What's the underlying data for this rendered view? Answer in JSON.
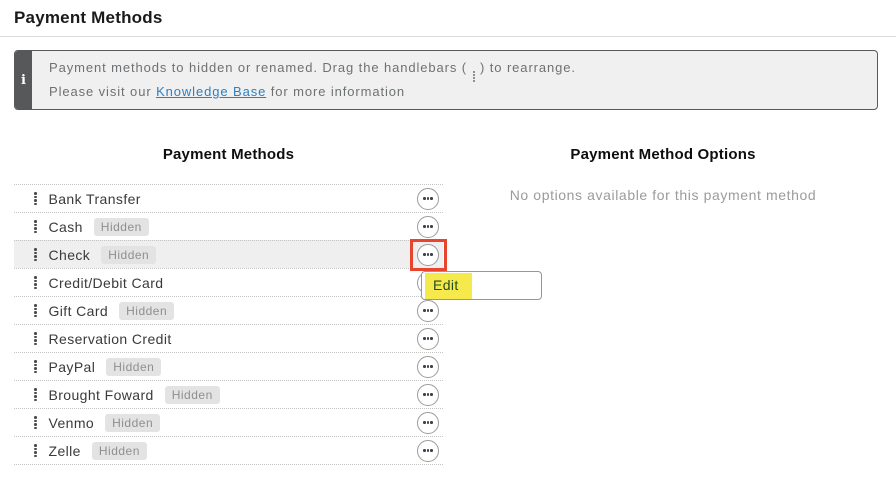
{
  "page": {
    "title": "Payment Methods"
  },
  "banner": {
    "icon": "i",
    "line1_before": "Payment methods to hidden or renamed. Drag the handlebars ( ",
    "line1_after": " ) to rearrange.",
    "line2_before": "Please visit our ",
    "link_label": "Knowledge Base",
    "line2_after": " for more information"
  },
  "columns": {
    "left_header": "Payment Methods",
    "right_header": "Payment Method Options"
  },
  "options_panel": {
    "empty_text": "No options available for this payment method"
  },
  "hidden_badge_label": "Hidden",
  "methods": [
    {
      "name": "Bank Transfer",
      "hidden": false,
      "selected": false,
      "annotated": false
    },
    {
      "name": "Cash",
      "hidden": true,
      "selected": false,
      "annotated": false
    },
    {
      "name": "Check",
      "hidden": true,
      "selected": true,
      "annotated": true
    },
    {
      "name": "Credit/Debit Card",
      "hidden": false,
      "selected": false,
      "annotated": false
    },
    {
      "name": "Gift Card",
      "hidden": true,
      "selected": false,
      "annotated": false
    },
    {
      "name": "Reservation Credit",
      "hidden": false,
      "selected": false,
      "annotated": false
    },
    {
      "name": "PayPal",
      "hidden": true,
      "selected": false,
      "annotated": false
    },
    {
      "name": "Brought Foward",
      "hidden": true,
      "selected": false,
      "annotated": false
    },
    {
      "name": "Venmo",
      "hidden": true,
      "selected": false,
      "annotated": false
    },
    {
      "name": "Zelle",
      "hidden": true,
      "selected": false,
      "annotated": false
    }
  ],
  "context_menu": {
    "items": [
      {
        "label": "Edit",
        "highlighted": true
      }
    ]
  },
  "colors": {
    "annotation_red": "#e8442e",
    "highlight_yellow": "#f6e94b",
    "link_blue": "#2e80c1",
    "banner_strip_gray": "#57585a",
    "selected_row_gray": "#efefef"
  }
}
